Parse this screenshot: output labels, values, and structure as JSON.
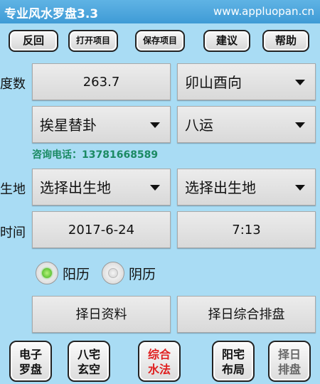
{
  "titlebar": {
    "title": "专业风水罗盘3.3",
    "url": "www.appluopan.cn"
  },
  "toolbar": {
    "back": "反回",
    "open_project": "打开项目",
    "save_project": "保存项目",
    "suggest": "建议",
    "help": "帮助"
  },
  "form": {
    "degree_label": "度数",
    "degree_value": "263.7",
    "direction_value": "卯山酉向",
    "star_method_value": "挨星替卦",
    "period_value": "八运",
    "phone": "咨询电话：13781668589",
    "birthplace_label": "生地",
    "birthplace_1": "选择出生地",
    "birthplace_2": "选择出生地",
    "time_label": "时间",
    "date_value": "2017-6-24",
    "time_value": "7:13",
    "solar_label": "阳历",
    "lunar_label": "阴历",
    "calendar_selected": "阳历",
    "date_select_info": "择日资料",
    "date_select_chart": "择日综合排盘"
  },
  "bottom_nav": [
    {
      "line1": "电子",
      "line2": "罗盘"
    },
    {
      "line1": "八宅",
      "line2": "玄空"
    },
    {
      "line1": "综合",
      "line2": "水法"
    },
    {
      "line1": "阳宅",
      "line2": "布局"
    },
    {
      "line1": "择日",
      "line2": "排盘"
    }
  ],
  "colors": {
    "background": "#a9dcf4",
    "titlebar": "#4aa7dd",
    "phone_text": "#1b8a63",
    "active_nav": "#e02020"
  }
}
